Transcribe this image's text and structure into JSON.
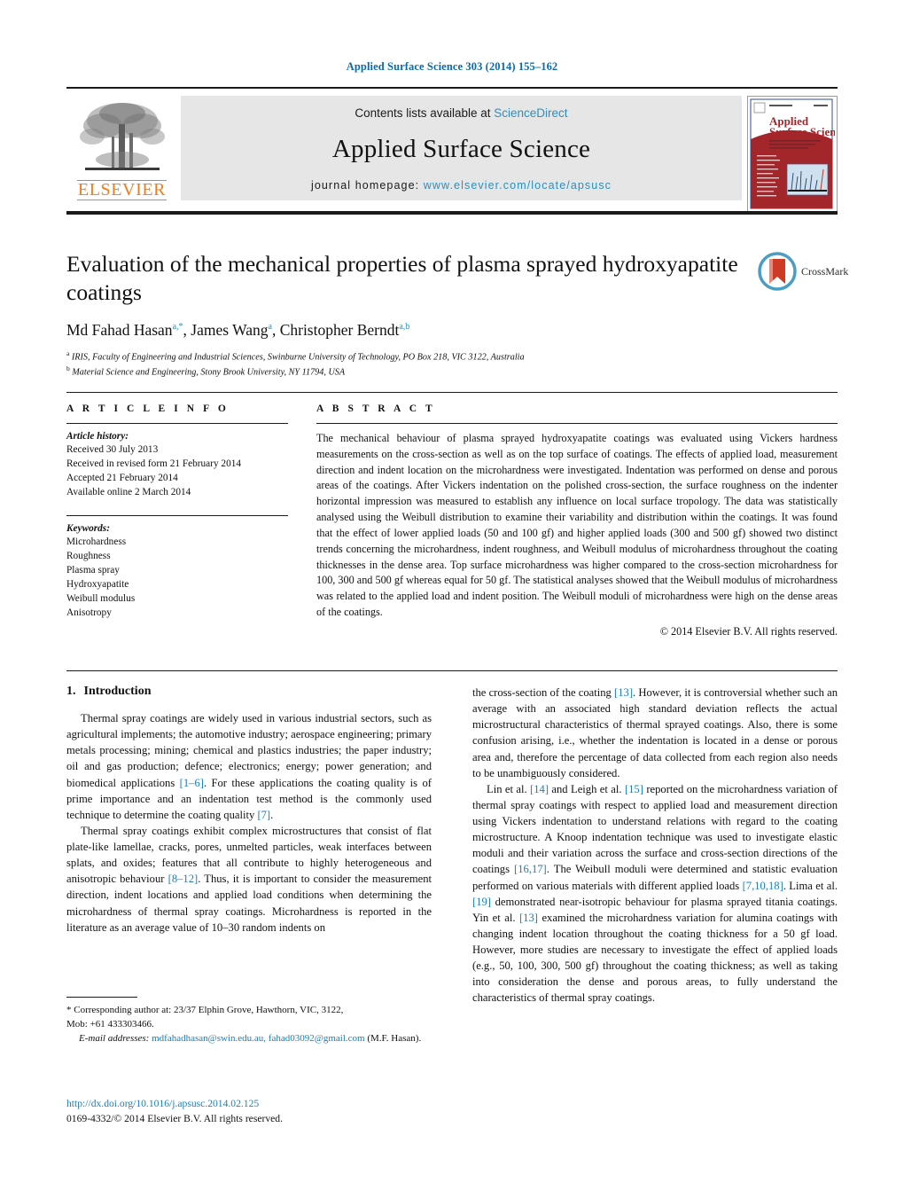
{
  "running_head": "Applied Surface Science 303 (2014) 155–162",
  "masthead": {
    "publisher_name": "ELSEVIER",
    "contents_prefix": "Contents lists available at",
    "sciencedirect_label": "ScienceDirect",
    "journal_name": "Applied Surface Science",
    "homepage_prefix": "journal homepage:",
    "homepage_url": "www.elsevier.com/locate/apsusc",
    "cover": {
      "title_line1": "Applied",
      "title_line2": "Surface Science"
    },
    "colors": {
      "link_blue": "#2a8fbd",
      "elsevier_orange": "#f07d19",
      "band_grey": "#e6e6e6",
      "cover_red": "#a3262b"
    }
  },
  "title_block": {
    "title": "Evaluation of the mechanical properties of plasma sprayed hydroxyapatite coatings",
    "authors": [
      {
        "name": "Md Fahad Hasan",
        "sup": "a,*"
      },
      {
        "name": "James Wang",
        "sup": "a"
      },
      {
        "name": "Christopher Berndt",
        "sup": "a,b"
      }
    ],
    "affiliations": [
      {
        "mark": "a",
        "text": "IRIS, Faculty of Engineering and Industrial Sciences, Swinburne University of Technology, PO Box 218, VIC 3122, Australia"
      },
      {
        "mark": "b",
        "text": "Material Science and Engineering, Stony Brook University, NY 11794, USA"
      }
    ],
    "crossmark_label": "CrossMark"
  },
  "article_info": {
    "heading": "A R T I C L E   I N F O",
    "history_label": "Article history:",
    "history": [
      "Received 30 July 2013",
      "Received in revised form 21 February 2014",
      "Accepted 21 February 2014",
      "Available online 2 March 2014"
    ],
    "keywords_label": "Keywords:",
    "keywords": [
      "Microhardness",
      "Roughness",
      "Plasma spray",
      "Hydroxyapatite",
      "Weibull modulus",
      "Anisotropy"
    ]
  },
  "abstract": {
    "heading": "A B S T R A C T",
    "text": "The mechanical behaviour of plasma sprayed hydroxyapatite coatings was evaluated using Vickers hardness measurements on the cross-section as well as on the top surface of coatings. The effects of applied load, measurement direction and indent location on the microhardness were investigated. Indentation was performed on dense and porous areas of the coatings. After Vickers indentation on the polished cross-section, the surface roughness on the indenter horizontal impression was measured to establish any influence on local surface tropology. The data was statistically analysed using the Weibull distribution to examine their variability and distribution within the coatings. It was found that the effect of lower applied loads (50 and 100 gf) and higher applied loads (300 and 500 gf) showed two distinct trends concerning the microhardness, indent roughness, and Weibull modulus of microhardness throughout the coating thicknesses in the dense area. Top surface microhardness was higher compared to the cross-section microhardness for 100, 300 and 500 gf whereas equal for 50 gf. The statistical analyses showed that the Weibull modulus of microhardness was related to the applied load and indent position. The Weibull moduli of microhardness were high on the dense areas of the coatings.",
    "copyright": "© 2014 Elsevier B.V. All rights reserved."
  },
  "body": {
    "section_number": "1.",
    "section_title": "Introduction",
    "left_paragraphs": [
      "Thermal spray coatings are widely used in various industrial sectors, such as agricultural implements; the automotive industry; aerospace engineering; primary metals processing; mining; chemical and plastics industries; the paper industry; oil and gas production; defence; electronics; energy; power generation; and biomedical applications [1–6]. For these applications the coating quality is of prime importance and an indentation test method is the commonly used technique to determine the coating quality [7].",
      "Thermal spray coatings exhibit complex microstructures that consist of flat plate-like lamellae, cracks, pores, unmelted particles, weak interfaces between splats, and oxides; features that all contribute to highly heterogeneous and anisotropic behaviour [8–12]. Thus, it is important to consider the measurement direction, indent locations and applied load conditions when determining the microhardness of thermal spray coatings. Microhardness is reported in the literature as an average value of 10–30 random indents on"
    ],
    "right_paragraphs": [
      "the cross-section of the coating [13]. However, it is controversial whether such an average with an associated high standard deviation reflects the actual microstructural characteristics of thermal sprayed coatings. Also, there is some confusion arising, i.e., whether the indentation is located in a dense or porous area and, therefore the percentage of data collected from each region also needs to be unambiguously considered.",
      "Lin et al. [14] and Leigh et al. [15] reported on the microhardness variation of thermal spray coatings with respect to applied load and measurement direction using Vickers indentation to understand relations with regard to the coating microstructure. A Knoop indentation technique was used to investigate elastic moduli and their variation across the surface and cross-section directions of the coatings [16,17]. The Weibull moduli were determined and statistic evaluation performed on various materials with different applied loads [7,10,18]. Lima et al. [19] demonstrated near-isotropic behaviour for plasma sprayed titania coatings. Yin et al. [13] examined the microhardness variation for alumina coatings with changing indent location throughout the coating thickness for a 50 gf load. However, more studies are necessary to investigate the effect of applied loads (e.g., 50, 100, 300, 500 gf) throughout the coating thickness; as well as taking into consideration the dense and porous areas, to fully understand the characteristics of thermal spray coatings."
    ],
    "reference_marks": [
      "[1–6]",
      "[7]",
      "[8–12]",
      "[13]",
      "[14]",
      "[15]",
      "[16,17]",
      "[7,10,18]",
      "[19]"
    ]
  },
  "footnotes": {
    "corresponding_line1": "* Corresponding author at: 23/37 Elphin Grove, Hawthorn, VIC, 3122,",
    "corresponding_line2": "Mob: +61 433303466.",
    "email_label": "E-mail addresses:",
    "emails": "mdfahadhasan@swin.edu.au, fahad03092@gmail.com",
    "email_attrib": "(M.F. Hasan).",
    "doi": "http://dx.doi.org/10.1016/j.apsusc.2014.02.125",
    "issn_line": "0169-4332/© 2014 Elsevier B.V. All rights reserved."
  }
}
